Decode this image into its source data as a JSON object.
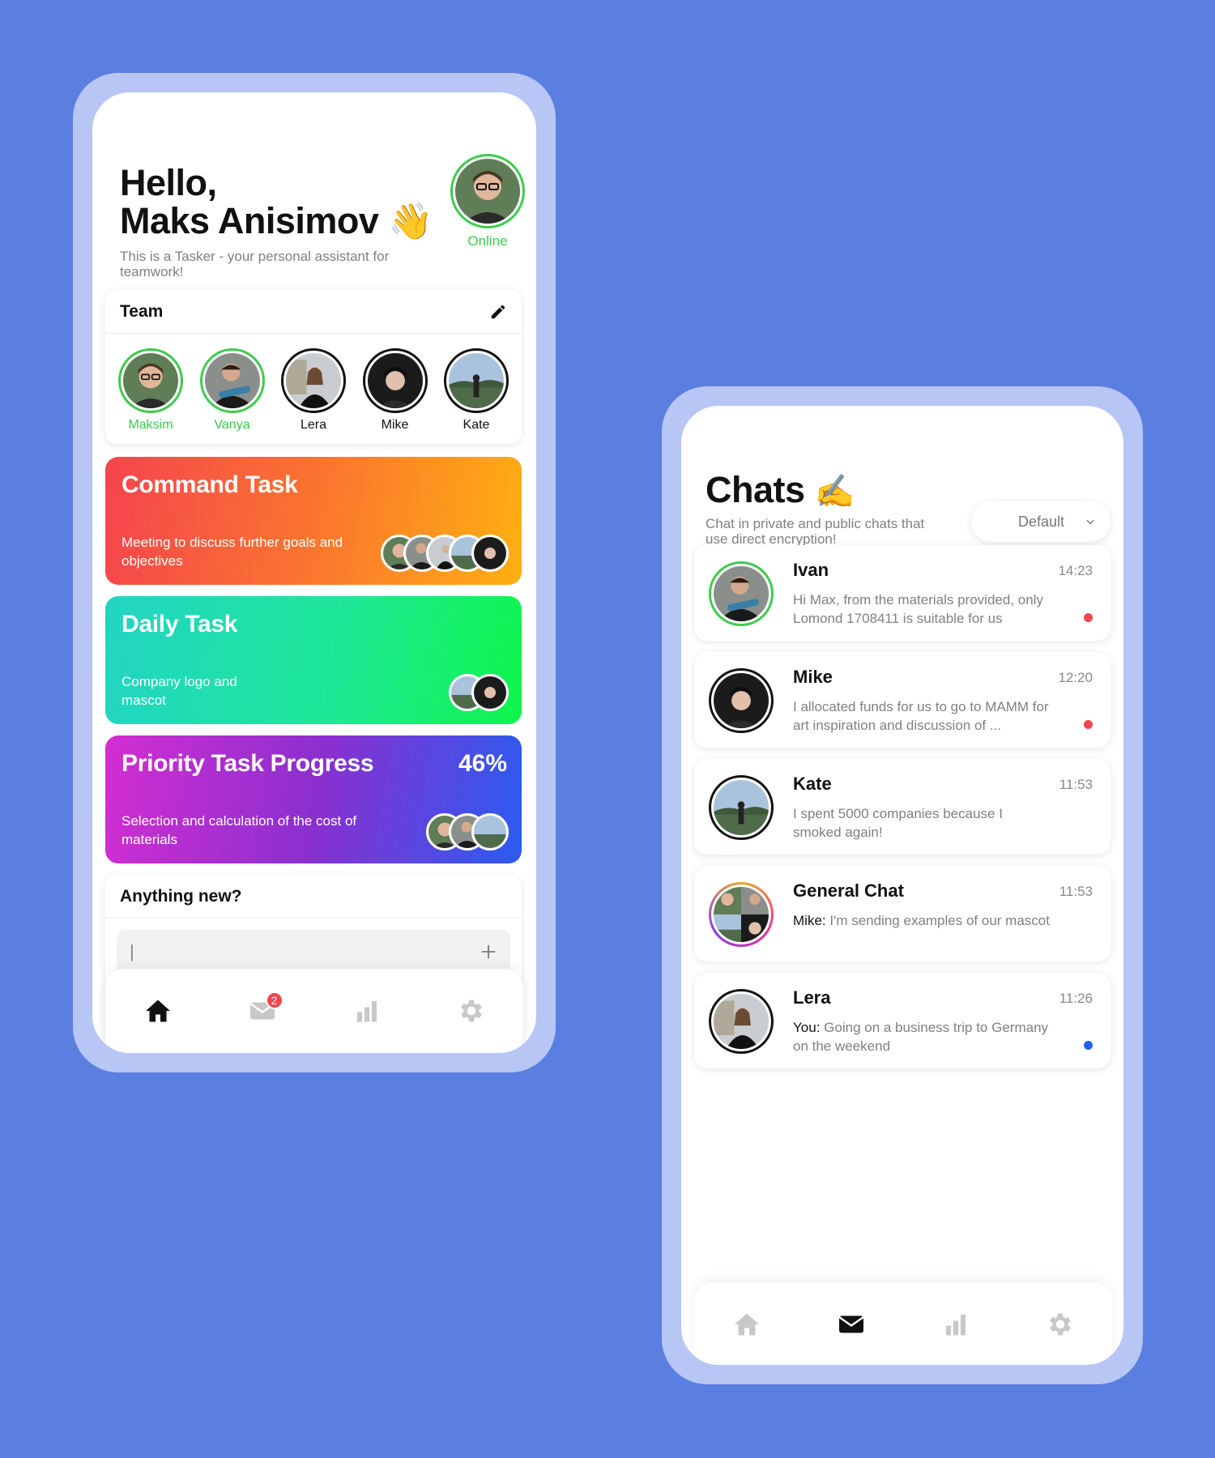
{
  "home": {
    "greeting_line1": "Hello,",
    "greeting_line2": "Maks Anisimov",
    "greeting_emoji": "👋",
    "subtitle": "This is a Tasker - your personal assistant for teamwork!",
    "status": "Online",
    "team": {
      "title": "Team",
      "edit_icon": "pencil-icon",
      "members": [
        {
          "name": "Maksim",
          "online": true
        },
        {
          "name": "Vanya",
          "online": true
        },
        {
          "name": "Lera",
          "online": false
        },
        {
          "name": "Mike",
          "online": false
        },
        {
          "name": "Kate",
          "online": false
        }
      ]
    },
    "tasks": [
      {
        "title": "Command Task",
        "description": "Meeting to discuss further goals and objectives",
        "colors": [
          "#f5444e",
          "#ffb012"
        ]
      },
      {
        "title": "Daily Task",
        "description": "Company logo and mascot",
        "colors": [
          "#22d4c4",
          "#0ef54a"
        ]
      },
      {
        "title": "Priority Task Progress",
        "description": "Selection and calculation of the cost of materials",
        "progress": "46%",
        "colors": [
          "#d42ed1",
          "#2a5cf0"
        ]
      }
    ],
    "composer": {
      "title": "Anything new?",
      "cursor": "|",
      "add_icon": "plus-icon"
    },
    "tabbar": {
      "mail_badge": "2",
      "icons": [
        "home-icon",
        "mail-icon",
        "chart-icon",
        "gear-icon"
      ]
    }
  },
  "chats": {
    "title": "Chats",
    "emoji": "✍️",
    "subtitle": "Chat in private and public chats that use direct encryption!",
    "sort": {
      "selected": "Default",
      "icon": "chevron-down-icon"
    },
    "items": [
      {
        "name": "Ivan",
        "time": "14:23",
        "sender": "",
        "message": "Hi Max, from the materials provided, only Lomond 1708411 is suitable for us",
        "indicator": "#f2454e"
      },
      {
        "name": "Mike",
        "time": "12:20",
        "sender": "",
        "message": "I allocated funds for us to go to MAMM for art inspiration and discussion of ...",
        "indicator": "#f2454e"
      },
      {
        "name": "Kate",
        "time": "11:53",
        "sender": "",
        "message": "I spent 5000 companies because I smoked again!",
        "indicator": ""
      },
      {
        "name": "General Chat",
        "time": "11:53",
        "sender": "Mike:",
        "message": "I'm sending examples of our mascot",
        "indicator": ""
      },
      {
        "name": "Lera",
        "time": "11:26",
        "sender": "You:",
        "message": "Going on a business trip to Germany on the weekend",
        "indicator": "#1e63f0"
      }
    ],
    "tabbar": {
      "icons": [
        "home-icon",
        "mail-icon",
        "chart-icon",
        "gear-icon"
      ]
    }
  },
  "colors": {
    "background": "#5b7fe0",
    "frame": "#b7c6f4",
    "online": "#3ccc4c",
    "unread": "#f2454e",
    "sent": "#1e63f0"
  }
}
